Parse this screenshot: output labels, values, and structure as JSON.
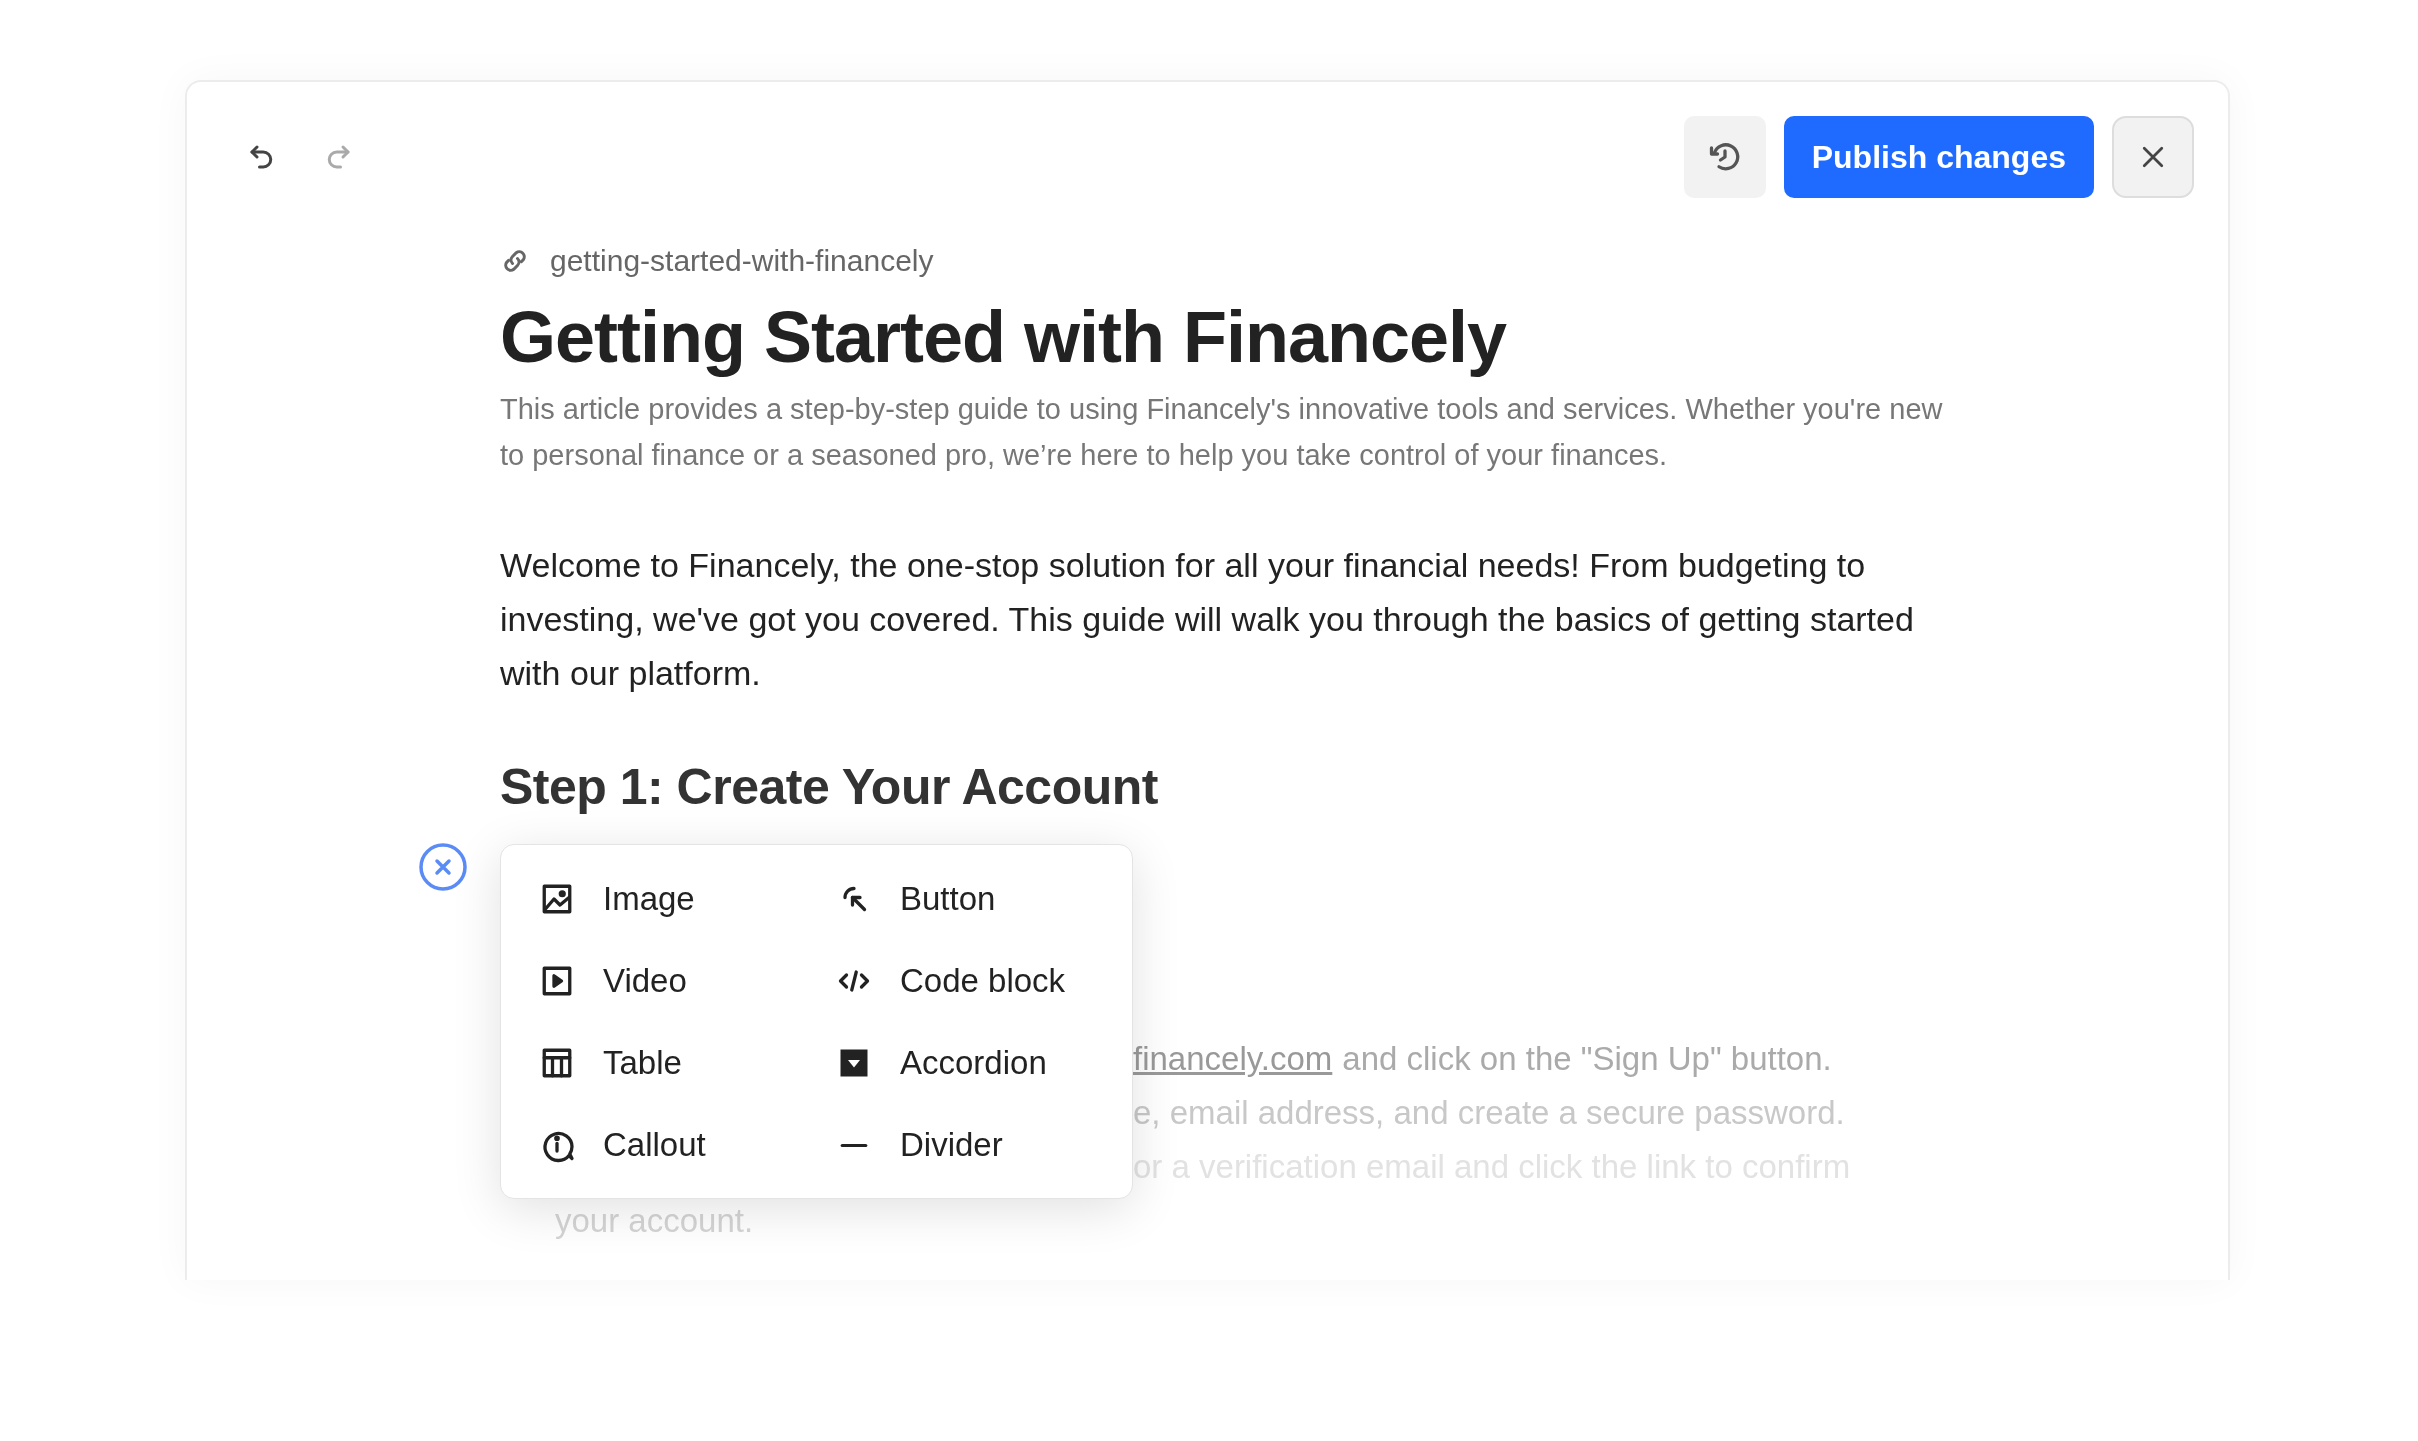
{
  "toolbar": {
    "undo": {
      "disabled": false
    },
    "redo": {
      "disabled": true
    },
    "publish_button": "Publish changes"
  },
  "article": {
    "slug": "getting-started-with-financely",
    "title": "Getting Started with Financely",
    "summary": "This article provides a step-by-step guide to using Financely's innovative tools and services. Whether you're new to personal finance or a seasoned pro, we’re here to help you take control of your finances.",
    "intro": "Welcome to Financely, the one-stop solution for all your financial needs! From budgeting to investing, we've got you covered. This guide will walk you through the basics of getting started with our platform.",
    "heading": "Step 1: Create Your Account",
    "partial_lines": [
      {
        "link": "financely.com",
        "text": "and click on the \"Sign Up\" button."
      },
      {
        "text": "e, email address, and create a secure password."
      },
      {
        "text": "or a verification email and click the link to confirm"
      },
      {
        "text": "your account."
      }
    ]
  },
  "insert_menu": {
    "items": [
      {
        "label": "Image",
        "kind": "image"
      },
      {
        "label": "Button",
        "kind": "button"
      },
      {
        "label": "Video",
        "kind": "video"
      },
      {
        "label": "Code block",
        "kind": "code"
      },
      {
        "label": "Table",
        "kind": "table"
      },
      {
        "label": "Accordion",
        "kind": "accordion"
      },
      {
        "label": "Callout",
        "kind": "callout"
      },
      {
        "label": "Divider",
        "kind": "divider"
      }
    ]
  }
}
